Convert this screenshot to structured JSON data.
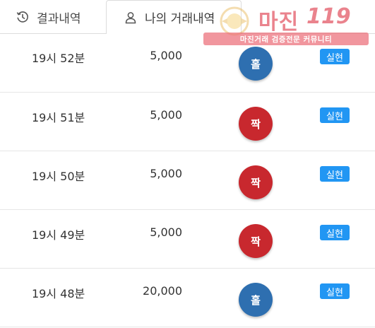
{
  "tabs": {
    "results_label": "결과내역",
    "mine_label": "나의 거래내역",
    "results_icon": "history-icon",
    "mine_icon": "user-icon"
  },
  "watermark": {
    "title": "마진",
    "number": "119",
    "subtitle": "마진거래 검증전문 커뮤니티"
  },
  "colors": {
    "odd_ball": "#2e6fb0",
    "even_ball": "#c8282e",
    "badge": "#2196f3"
  },
  "rows": [
    {
      "time": "19시 52분",
      "amount": "5,000",
      "result": "홀",
      "result_type": "odd",
      "status": "실현"
    },
    {
      "time": "19시 51분",
      "amount": "5,000",
      "result": "짝",
      "result_type": "even",
      "status": "실현"
    },
    {
      "time": "19시 50분",
      "amount": "5,000",
      "result": "짝",
      "result_type": "even",
      "status": "실현"
    },
    {
      "time": "19시 49분",
      "amount": "5,000",
      "result": "짝",
      "result_type": "even",
      "status": "실현"
    },
    {
      "time": "19시 48분",
      "amount": "20,000",
      "result": "홀",
      "result_type": "odd",
      "status": "실현"
    }
  ]
}
